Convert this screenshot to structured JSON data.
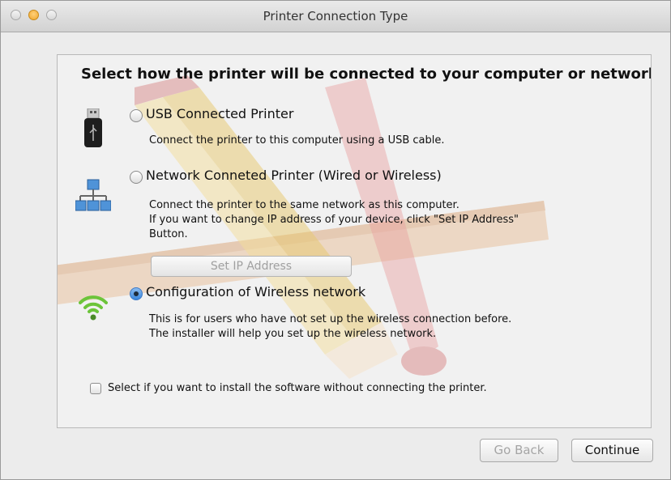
{
  "window": {
    "title": "Printer Connection Type"
  },
  "dialog": {
    "heading": "Select how the printer will be connected to your computer or network.",
    "options": [
      {
        "label": "USB Connected Printer",
        "description": [
          "Connect the printer to this computer using a USB cable."
        ],
        "selected": false,
        "icon": "usb-icon"
      },
      {
        "label": "Network Conneted Printer (Wired or Wireless)",
        "description": [
          "Connect the printer to the same network as this computer.",
          "If you want to change IP address of your device, click \"Set IP Address\"",
          "Button."
        ],
        "selected": false,
        "icon": "network-icon"
      },
      {
        "label": "Configuration of Wireless network",
        "description": [
          "This is for users who have not set up the wireless connection before.",
          "The installer will help you set up the wireless network."
        ],
        "selected": true,
        "icon": "wifi-icon"
      }
    ],
    "set_ip_button": "Set IP Address",
    "skip_checkbox": {
      "label": "Select if you want to install the software without connecting the printer.",
      "checked": false
    }
  },
  "footer": {
    "back_label": "Go Back",
    "continue_label": "Continue"
  },
  "colors": {
    "accent": "#3a86dd",
    "wifi": "#6cc43a"
  }
}
